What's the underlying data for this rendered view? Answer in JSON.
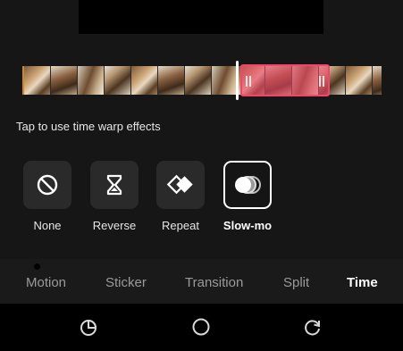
{
  "hint": "Tap to use time warp effects",
  "effects": [
    {
      "label": "None",
      "icon": "none-icon",
      "active": false
    },
    {
      "label": "Reverse",
      "icon": "reverse-icon",
      "active": false
    },
    {
      "label": "Repeat",
      "icon": "repeat-icon",
      "active": false
    },
    {
      "label": "Slow-mo",
      "icon": "slowmo-icon",
      "active": true
    }
  ],
  "tabs": [
    {
      "label": "Motion",
      "active": false
    },
    {
      "label": "Sticker",
      "active": false
    },
    {
      "label": "Transition",
      "active": false
    },
    {
      "label": "Split",
      "active": false
    },
    {
      "label": "Time",
      "active": true
    }
  ],
  "colors": {
    "accent": "#f2456a",
    "background": "#161616"
  },
  "nav_icons": [
    "recent-apps-icon",
    "home-icon",
    "back-icon"
  ]
}
